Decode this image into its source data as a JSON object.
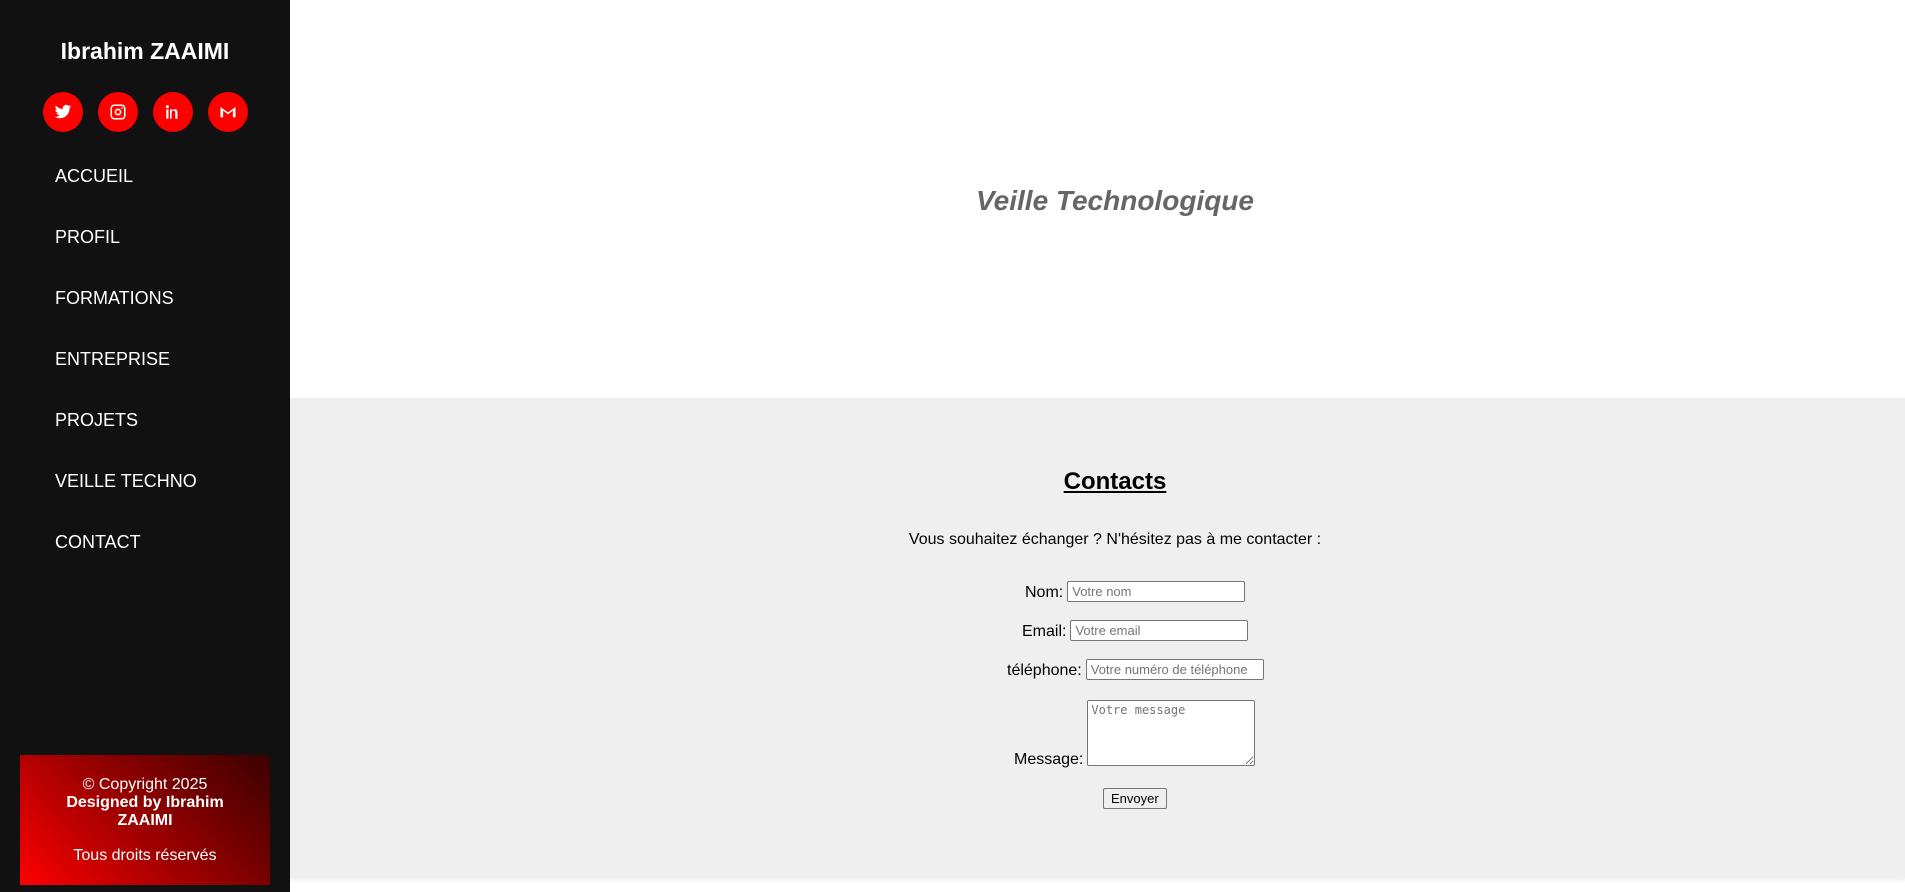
{
  "sidebar": {
    "brand": "Ibrahim ZAAIMI",
    "social": [
      {
        "icon": "twitter-icon"
      },
      {
        "icon": "instagram-icon"
      },
      {
        "icon": "linkedin-icon"
      },
      {
        "icon": "gmail-icon"
      }
    ],
    "nav": [
      {
        "label": "ACCUEIL"
      },
      {
        "label": "PROFIL"
      },
      {
        "label": "FORMATIONS"
      },
      {
        "label": "ENTREPRISE"
      },
      {
        "label": "PROJETS"
      },
      {
        "label": "VEILLE TECHNO"
      },
      {
        "label": "CONTACT"
      }
    ],
    "footer": {
      "copyright": "© Copyright 2025",
      "designed": "Designed by Ibrahim ZAAIMI",
      "rights": "Tous droits réservés"
    }
  },
  "hero": {
    "title": "Veille Technologique"
  },
  "contact": {
    "title": "Contacts",
    "intro": "Vous souhaitez échanger ? N'hésitez pas à me contacter :",
    "fields": {
      "name_label": "Nom:",
      "name_placeholder": "Votre nom",
      "email_label": "Email:",
      "email_placeholder": "Votre email",
      "phone_label": "téléphone:",
      "phone_placeholder": "Votre numéro de téléphone",
      "message_label": "Message:",
      "message_placeholder": "Votre message"
    },
    "submit_label": "Envoyer"
  },
  "colors": {
    "sidebar_bg": "#111111",
    "accent": "#ff0000",
    "hero_title": "#666666",
    "contact_bg": "#efefef"
  }
}
